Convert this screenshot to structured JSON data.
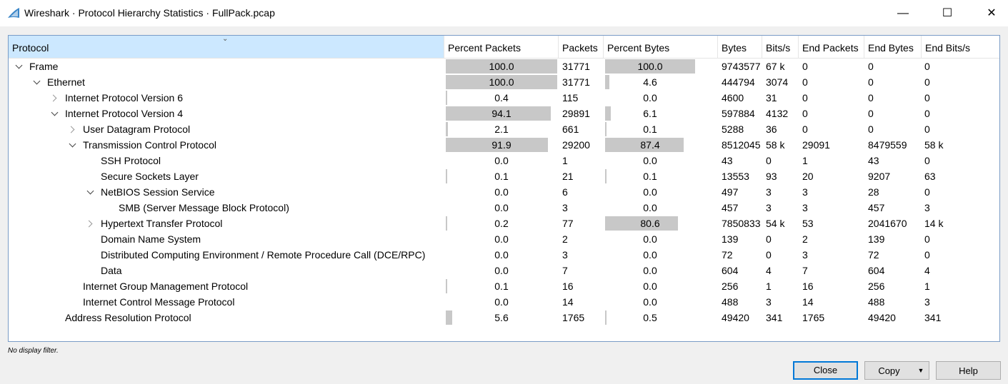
{
  "window": {
    "title": "Wireshark · Protocol Hierarchy Statistics · FullPack.pcap",
    "minimize": "—",
    "maximize": "☐",
    "close": "✕"
  },
  "columns": [
    "Protocol",
    "Percent Packets",
    "Packets",
    "Percent Bytes",
    "Bytes",
    "Bits/s",
    "End Packets",
    "End Bytes",
    "End Bits/s"
  ],
  "rows": [
    {
      "name": "Frame",
      "depth": 0,
      "expander": "open",
      "pct_packets": "100.0",
      "packets": "31771",
      "pct_bytes": "100.0",
      "bytes": "9743577",
      "bits": "67 k",
      "end_packets": "0",
      "end_bytes": "0",
      "end_bits": "0",
      "pct_packets_value": 100.0,
      "pct_bytes_value": 100.0
    },
    {
      "name": "Ethernet",
      "depth": 1,
      "expander": "open",
      "pct_packets": "100.0",
      "packets": "31771",
      "pct_bytes": "4.6",
      "bytes": "444794",
      "bits": "3074",
      "end_packets": "0",
      "end_bytes": "0",
      "end_bits": "0",
      "pct_packets_value": 100.0,
      "pct_bytes_value": 4.6
    },
    {
      "name": "Internet Protocol Version 6",
      "depth": 2,
      "expander": "closed",
      "pct_packets": "0.4",
      "packets": "115",
      "pct_bytes": "0.0",
      "bytes": "4600",
      "bits": "31",
      "end_packets": "0",
      "end_bytes": "0",
      "end_bits": "0",
      "pct_packets_value": 0.4,
      "pct_bytes_value": 0.0
    },
    {
      "name": "Internet Protocol Version 4",
      "depth": 2,
      "expander": "open",
      "pct_packets": "94.1",
      "packets": "29891",
      "pct_bytes": "6.1",
      "bytes": "597884",
      "bits": "4132",
      "end_packets": "0",
      "end_bytes": "0",
      "end_bits": "0",
      "pct_packets_value": 94.1,
      "pct_bytes_value": 6.1
    },
    {
      "name": "User Datagram Protocol",
      "depth": 3,
      "expander": "closed",
      "pct_packets": "2.1",
      "packets": "661",
      "pct_bytes": "0.1",
      "bytes": "5288",
      "bits": "36",
      "end_packets": "0",
      "end_bytes": "0",
      "end_bits": "0",
      "pct_packets_value": 2.1,
      "pct_bytes_value": 0.1
    },
    {
      "name": "Transmission Control Protocol",
      "depth": 3,
      "expander": "open",
      "pct_packets": "91.9",
      "packets": "29200",
      "pct_bytes": "87.4",
      "bytes": "8512045",
      "bits": "58 k",
      "end_packets": "29091",
      "end_bytes": "8479559",
      "end_bits": "58 k",
      "pct_packets_value": 91.9,
      "pct_bytes_value": 87.4
    },
    {
      "name": "SSH Protocol",
      "depth": 4,
      "expander": "none",
      "pct_packets": "0.0",
      "packets": "1",
      "pct_bytes": "0.0",
      "bytes": "43",
      "bits": "0",
      "end_packets": "1",
      "end_bytes": "43",
      "end_bits": "0",
      "pct_packets_value": 0.0,
      "pct_bytes_value": 0.0
    },
    {
      "name": "Secure Sockets Layer",
      "depth": 4,
      "expander": "none",
      "pct_packets": "0.1",
      "packets": "21",
      "pct_bytes": "0.1",
      "bytes": "13553",
      "bits": "93",
      "end_packets": "20",
      "end_bytes": "9207",
      "end_bits": "63",
      "pct_packets_value": 0.1,
      "pct_bytes_value": 0.1
    },
    {
      "name": "NetBIOS Session Service",
      "depth": 4,
      "expander": "open",
      "pct_packets": "0.0",
      "packets": "6",
      "pct_bytes": "0.0",
      "bytes": "497",
      "bits": "3",
      "end_packets": "3",
      "end_bytes": "28",
      "end_bits": "0",
      "pct_packets_value": 0.0,
      "pct_bytes_value": 0.0
    },
    {
      "name": "SMB (Server Message Block Protocol)",
      "depth": 5,
      "expander": "none",
      "pct_packets": "0.0",
      "packets": "3",
      "pct_bytes": "0.0",
      "bytes": "457",
      "bits": "3",
      "end_packets": "3",
      "end_bytes": "457",
      "end_bits": "3",
      "pct_packets_value": 0.0,
      "pct_bytes_value": 0.0
    },
    {
      "name": "Hypertext Transfer Protocol",
      "depth": 4,
      "expander": "closed",
      "pct_packets": "0.2",
      "packets": "77",
      "pct_bytes": "80.6",
      "bytes": "7850833",
      "bits": "54 k",
      "end_packets": "53",
      "end_bytes": "2041670",
      "end_bits": "14 k",
      "pct_packets_value": 0.2,
      "pct_bytes_value": 80.6
    },
    {
      "name": "Domain Name System",
      "depth": 4,
      "expander": "none",
      "pct_packets": "0.0",
      "packets": "2",
      "pct_bytes": "0.0",
      "bytes": "139",
      "bits": "0",
      "end_packets": "2",
      "end_bytes": "139",
      "end_bits": "0",
      "pct_packets_value": 0.0,
      "pct_bytes_value": 0.0
    },
    {
      "name": "Distributed Computing Environment / Remote Procedure Call (DCE/RPC)",
      "depth": 4,
      "expander": "none",
      "pct_packets": "0.0",
      "packets": "3",
      "pct_bytes": "0.0",
      "bytes": "72",
      "bits": "0",
      "end_packets": "3",
      "end_bytes": "72",
      "end_bits": "0",
      "pct_packets_value": 0.0,
      "pct_bytes_value": 0.0
    },
    {
      "name": "Data",
      "depth": 4,
      "expander": "none",
      "pct_packets": "0.0",
      "packets": "7",
      "pct_bytes": "0.0",
      "bytes": "604",
      "bits": "4",
      "end_packets": "7",
      "end_bytes": "604",
      "end_bits": "4",
      "pct_packets_value": 0.0,
      "pct_bytes_value": 0.0
    },
    {
      "name": "Internet Group Management Protocol",
      "depth": 3,
      "expander": "none",
      "pct_packets": "0.1",
      "packets": "16",
      "pct_bytes": "0.0",
      "bytes": "256",
      "bits": "1",
      "end_packets": "16",
      "end_bytes": "256",
      "end_bits": "1",
      "pct_packets_value": 0.1,
      "pct_bytes_value": 0.0
    },
    {
      "name": "Internet Control Message Protocol",
      "depth": 3,
      "expander": "none",
      "pct_packets": "0.0",
      "packets": "14",
      "pct_bytes": "0.0",
      "bytes": "488",
      "bits": "3",
      "end_packets": "14",
      "end_bytes": "488",
      "end_bits": "3",
      "pct_packets_value": 0.0,
      "pct_bytes_value": 0.0
    },
    {
      "name": "Address Resolution Protocol",
      "depth": 2,
      "expander": "none",
      "pct_packets": "5.6",
      "packets": "1765",
      "pct_bytes": "0.5",
      "bytes": "49420",
      "bits": "341",
      "end_packets": "1765",
      "end_bytes": "49420",
      "end_bits": "341",
      "pct_packets_value": 5.6,
      "pct_bytes_value": 0.5
    }
  ],
  "status": {
    "filter": "No display filter."
  },
  "buttons": {
    "close": "Close",
    "copy": "Copy",
    "help": "Help"
  },
  "colors": {
    "bar": "#c8c8c8",
    "header_selected": "#cce8ff",
    "accent": "#0078d7"
  }
}
